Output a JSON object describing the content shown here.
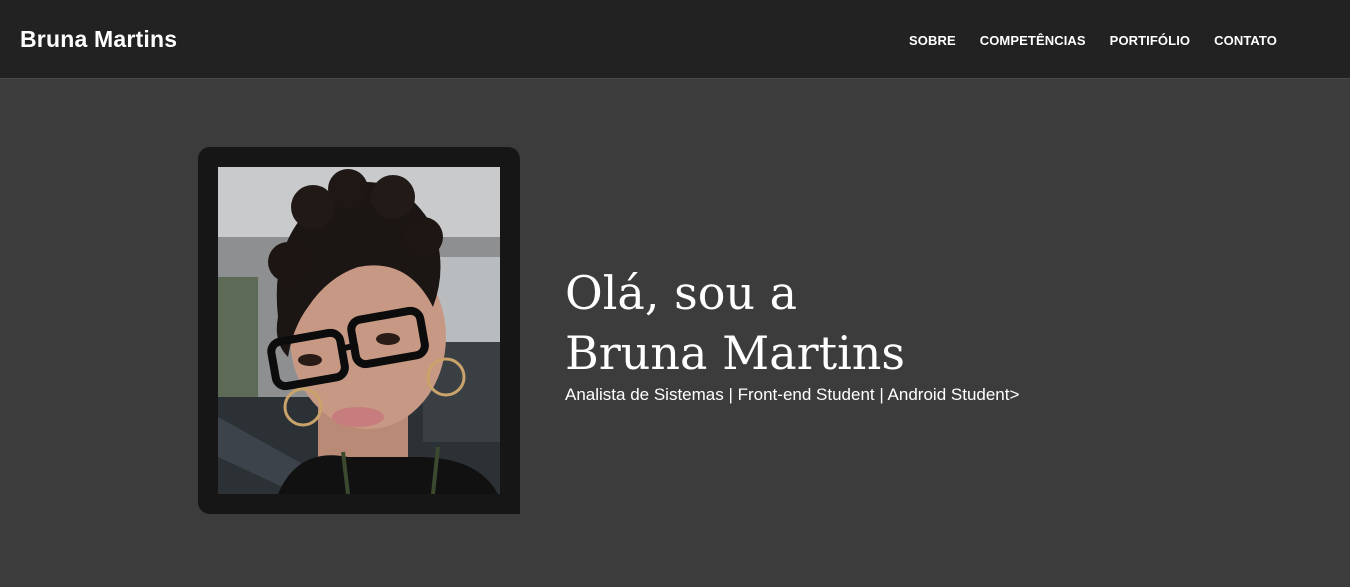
{
  "navbar": {
    "brand": "Bruna Martins",
    "links": [
      {
        "label": "SOBRE"
      },
      {
        "label": "COMPETÊNCIAS"
      },
      {
        "label": "PORTIFÓLIO"
      },
      {
        "label": "CONTATO"
      }
    ]
  },
  "hero": {
    "headline_line1": "Olá, sou a",
    "headline_line2": "Bruna Martins",
    "subtitle": "Analista de Sistemas | Front-end Student | Android Student>",
    "photo_alt": "Bruna Martins"
  },
  "colors": {
    "navbar_bg": "#222222",
    "page_bg": "#3c3c3c",
    "frame_bg": "#161616",
    "text": "#ffffff"
  }
}
